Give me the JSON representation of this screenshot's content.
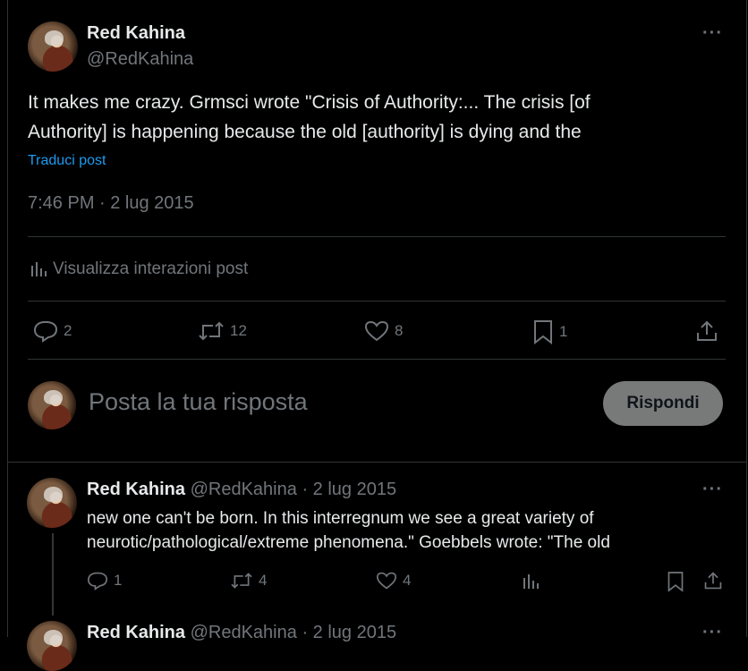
{
  "main_post": {
    "author_name": "Red Kahina",
    "author_handle": "@RedKahina",
    "text_line1": "It makes me crazy. Grmsci wrote \"Crisis of Authority:... The crisis [of",
    "text_line2": "Authority] is happening because the old [authority] is dying and the",
    "translate_label": "Traduci post",
    "timestamp": "7:46 PM · 2 lug 2015",
    "analytics_label": "Visualizza interazioni post",
    "actions": {
      "replies": "2",
      "reposts": "12",
      "likes": "8",
      "bookmarks": "1"
    }
  },
  "reply_box": {
    "placeholder": "Posta la tua risposta",
    "button_label": "Rispondi"
  },
  "replies": [
    {
      "author_name": "Red Kahina",
      "author_handle": "@RedKahina",
      "date": "· 2 lug 2015",
      "text_line1": "new one can't be born. In this interregnum we see a great variety of",
      "text_line2": "neurotic/pathological/extreme phenomena.\" Goebbels wrote: \"The old",
      "actions": {
        "replies": "1",
        "reposts": "4",
        "likes": "4"
      }
    },
    {
      "author_name": "Red Kahina",
      "author_handle": "@RedKahina",
      "date": "· 2 lug 2015"
    }
  ],
  "icons": [
    "more-icon",
    "reply-icon",
    "repost-icon",
    "like-icon",
    "bookmark-icon",
    "share-icon",
    "analytics-icon"
  ],
  "colors": {
    "background": "#000000",
    "text": "#e7e9ea",
    "muted": "#71767b",
    "link": "#1d9bf0",
    "button": "#787a7a"
  }
}
